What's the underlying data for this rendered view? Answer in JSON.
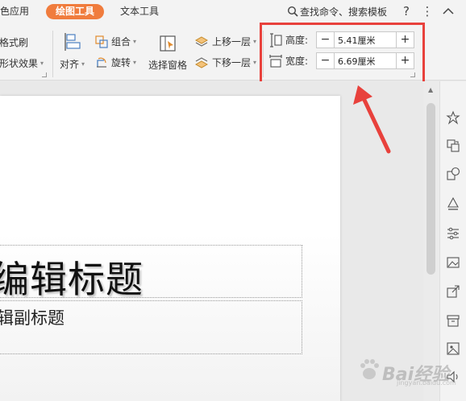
{
  "menu_tabs": {
    "special": "特色应用",
    "draw_tools": "绘图工具",
    "text_tools": "文本工具"
  },
  "search": {
    "label": "查找命令、搜索模板"
  },
  "ribbon": {
    "format_painter": "格式刷",
    "shape_effects": "形状效果",
    "align": "对齐",
    "group": "组合",
    "rotate": "旋转",
    "selection_pane": "选择窗格",
    "bring_forward": "上移一层",
    "send_backward": "下移一层",
    "height_label": "高度:",
    "height_value": "5.41厘米",
    "width_label": "宽度:",
    "width_value": "6.69厘米",
    "minus": "−",
    "plus": "+"
  },
  "slide": {
    "title": "编辑标题",
    "subtitle": "辑副标题"
  },
  "watermark": {
    "brand": "Bai",
    "brand_suffix": "经验",
    "sub": "jingyan.baidu.com"
  },
  "colors": {
    "accent": "#f07c3d",
    "highlight": "#e8413c"
  },
  "icons": [
    "search-icon",
    "help-icon",
    "more-icon",
    "collapse-icon",
    "align-icon",
    "group-icon",
    "rotate-icon",
    "selection-pane-icon",
    "bring-forward-icon",
    "send-backward-icon",
    "height-icon",
    "width-icon"
  ]
}
